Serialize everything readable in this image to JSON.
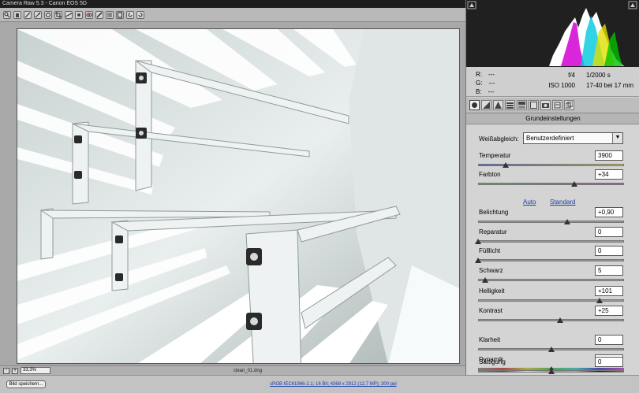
{
  "app": {
    "title": "Camera Raw 5.3  -  Canon EOS 5D"
  },
  "toolbar": {
    "tools": [
      "zoom-icon",
      "hand-icon",
      "white-balance-icon",
      "color-sampler-icon",
      "target-adjust-icon",
      "crop-icon",
      "straighten-icon",
      "spot-removal-icon",
      "red-eye-icon",
      "adjustment-brush-icon",
      "graduated-filter-icon",
      "preferences-icon",
      "rotate-left-icon",
      "rotate-right-icon"
    ]
  },
  "zoom": {
    "value": "33,3%"
  },
  "file": {
    "name": "clean_01.dng"
  },
  "footer": {
    "save_label": "Bild speichern...",
    "workflow_link": "sRGB IEC61966-2.1; 16 Bit; 4368 x 2912 (12,7 MP); 300 ppi"
  },
  "info": {
    "r_label": "R:",
    "r_value": "---",
    "g_label": "G:",
    "g_value": "---",
    "b_label": "B:",
    "b_value": "---",
    "aperture": "f/4",
    "shutter": "1/2000 s",
    "iso": "ISO 1000",
    "lens": "17-40 bei 17 mm"
  },
  "tabs": [
    "basic-tab",
    "tone-curve-tab",
    "detail-tab",
    "hsl-tab",
    "split-toning-tab",
    "lens-corrections-tab",
    "camera-calibration-tab",
    "presets-tab",
    "snapshots-tab"
  ],
  "section": {
    "title": "Grundeinstellungen"
  },
  "white_balance": {
    "label": "Weißabgleich:",
    "value": "Benutzerdefiniert"
  },
  "links": {
    "auto": "Auto",
    "standard": "Standard"
  },
  "sliders": [
    {
      "label": "Temperatur",
      "value": "3900",
      "position": 0.19,
      "track": "temp"
    },
    {
      "label": "Farbton",
      "value": "+34",
      "position": 0.66,
      "track": "tint"
    },
    {
      "label": "Belichtung",
      "value": "+0,90",
      "position": 0.61,
      "track": "gray"
    },
    {
      "label": "Reparatur",
      "value": "0",
      "position": 0.0,
      "track": "gray"
    },
    {
      "label": "Fülllicht",
      "value": "0",
      "position": 0.0,
      "track": "gray"
    },
    {
      "label": "Schwarz",
      "value": "5",
      "position": 0.05,
      "track": "gray"
    },
    {
      "label": "Helligkeit",
      "value": "+101",
      "position": 0.83,
      "track": "gray"
    },
    {
      "label": "Kontrast",
      "value": "+25",
      "position": 0.56,
      "track": "gray"
    },
    {
      "label": "Klarheit",
      "value": "0",
      "position": 0.5,
      "track": "gray"
    },
    {
      "label": "Dynamik",
      "value": "0",
      "position": 0.5,
      "track": "vibrance"
    },
    {
      "label": "Sättigung",
      "value": "0",
      "position": 0.5,
      "track": "vibrance"
    }
  ]
}
